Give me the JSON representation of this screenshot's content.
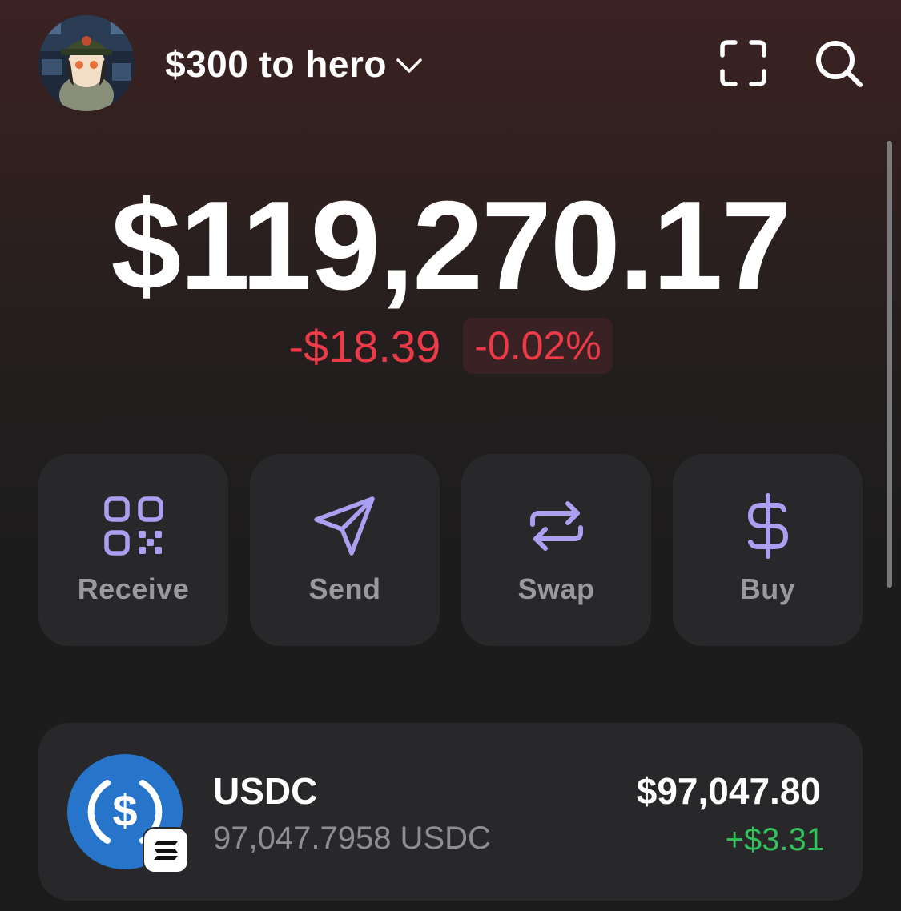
{
  "header": {
    "account_name": "$300 to hero",
    "avatar_icon": "avatar-icon",
    "scan_icon": "scan-icon",
    "search_icon": "search-icon"
  },
  "balance": {
    "total": "$119,270.17",
    "change_amount": "-$18.39",
    "change_percent": "-0.02%"
  },
  "actions": [
    {
      "label": "Receive",
      "icon": "qr-code-icon"
    },
    {
      "label": "Send",
      "icon": "send-icon"
    },
    {
      "label": "Swap",
      "icon": "swap-icon"
    },
    {
      "label": "Buy",
      "icon": "dollar-icon"
    }
  ],
  "tokens": [
    {
      "name": "USDC",
      "balance": "97,047.7958 USDC",
      "value": "$97,047.80",
      "change": "+$3.31",
      "icon": "usdc-icon",
      "chain_icon": "solana-icon"
    }
  ],
  "colors": {
    "accent": "#ab9ff2",
    "negative": "#ec3a48",
    "positive": "#33c15a",
    "card": "#28282b",
    "usdc_blue": "#2775ca"
  }
}
